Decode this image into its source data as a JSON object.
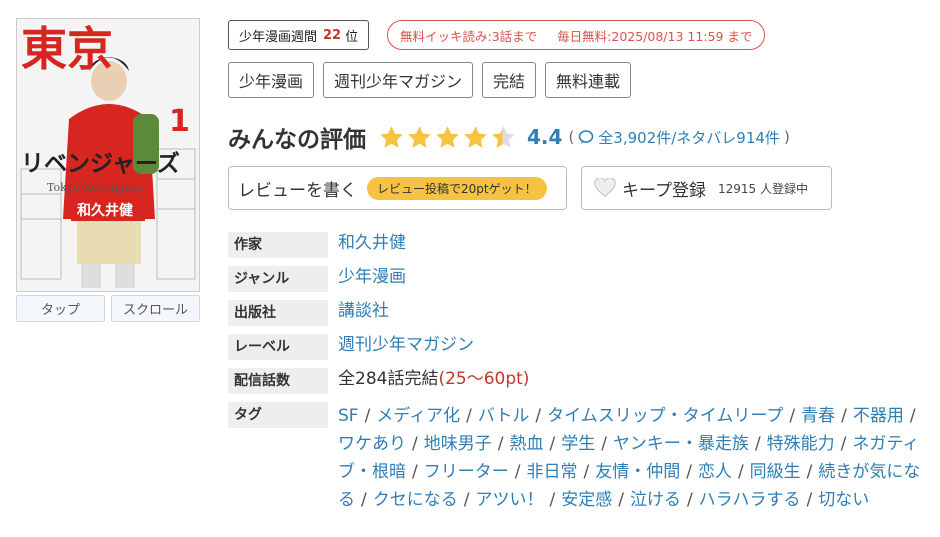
{
  "cover": {
    "title_kanji": "東京",
    "title_kana": "リベンジャーズ",
    "volume": "1",
    "subtitle": "Tokyo Revengers",
    "author": "和久井健"
  },
  "view_buttons": [
    "タップ",
    "スクロール"
  ],
  "rank": {
    "label": "少年漫画週間",
    "number": "22",
    "suffix": "位"
  },
  "free_notice": {
    "part1": "無料イッキ読み:3話まで",
    "part2": "毎日無料:2025/08/13 11:59 まで"
  },
  "badges": [
    "少年漫画",
    "週刊少年マガジン",
    "完結",
    "無料連載"
  ],
  "rating": {
    "title": "みんなの評価",
    "score": "4.4",
    "stars_value": 4.4,
    "open_paren": "(",
    "counts": "全3,902件/ネタバレ914件",
    "close_paren": ")"
  },
  "review_button": {
    "label": "レビューを書く",
    "pill": "レビュー投稿で20ptゲット！"
  },
  "keep_button": {
    "label": "キープ登録",
    "count": "12915 人登録中"
  },
  "info": {
    "author": {
      "key": "作家",
      "value": "和久井健"
    },
    "genre": {
      "key": "ジャンル",
      "value": "少年漫画"
    },
    "publisher": {
      "key": "出版社",
      "value": "講談社"
    },
    "label": {
      "key": "レーベル",
      "value": "週刊少年マガジン"
    },
    "episodes": {
      "key": "配信話数",
      "value": "全284話完結",
      "price": "(25〜60pt)"
    },
    "tags": {
      "key": "タグ",
      "items": [
        "SF",
        "メディア化",
        "バトル",
        "タイムスリップ・タイムリープ",
        "青春",
        "不器用",
        "ワケあり",
        "地味男子",
        "熱血",
        "学生",
        "ヤンキー・暴走族",
        "特殊能力",
        "ネガティブ・根暗",
        "フリーター",
        "非日常",
        "友情・仲間",
        "恋人",
        "同級生",
        "続きが気になる",
        "クセになる",
        "アツい！",
        "安定感",
        "泣ける",
        "ハラハラする",
        "切ない"
      ]
    }
  },
  "colors": {
    "accent": "#2f7fb5",
    "star": "#f5c242",
    "red": "#d9534f"
  }
}
